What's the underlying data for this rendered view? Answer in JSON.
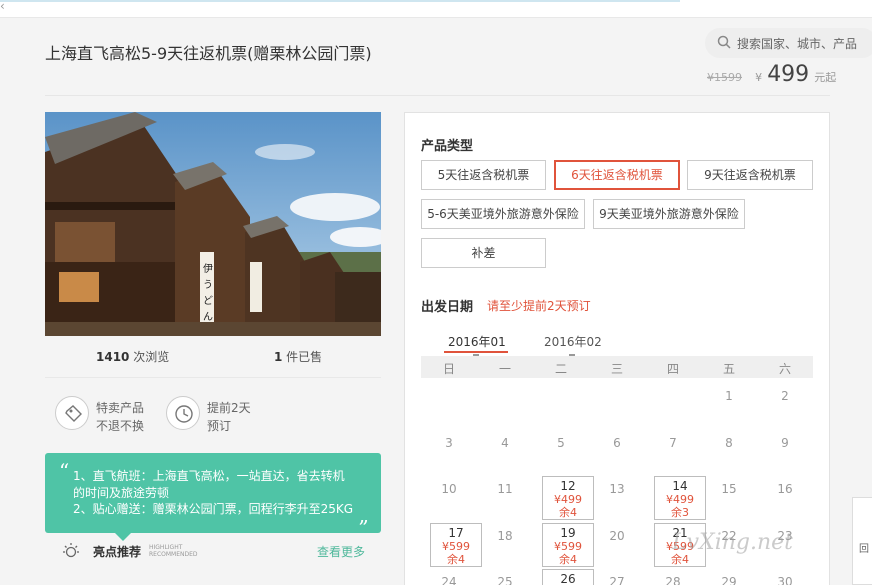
{
  "topbar": {
    "chevron": "‹"
  },
  "product": {
    "title": "上海直飞高松5-9天往返机票(赠栗林公园门票)",
    "old_price": "¥1599",
    "currency": "¥",
    "price": "499",
    "price_unit": "元起"
  },
  "search": {
    "placeholder": "搜索国家、城市、产品",
    "icon": "search-icon"
  },
  "stats": {
    "views_count": "1410",
    "views_label": " 次浏览",
    "sold_count": "1",
    "sold_label": " 件已售"
  },
  "features": [
    {
      "icon": "tag-icon",
      "line1": "特卖产品",
      "line2": "不退不换"
    },
    {
      "icon": "clock-icon",
      "line1": "提前2天",
      "line2": "预订"
    }
  ],
  "highlight": {
    "open_quote": "“",
    "close_quote": "„",
    "line1": "1、直飞航班：上海直飞高松，一站直达，省去转机",
    "line2": "的时间及旅途劳顿",
    "line3": "2、贴心赠送：赠栗林公园门票，回程行李升至25KG",
    "label": "亮点推荐",
    "label_en1": "HIGHLIGHT",
    "label_en2": "RECOMMENDED",
    "more": "查看更多",
    "icon": "sun-icon"
  },
  "product_type": {
    "title": "产品类型",
    "options": [
      "5天往返含税机票",
      "6天往返含税机票",
      "9天往返含税机票",
      "5-6天美亚境外旅游意外保险",
      "9天美亚境外旅游意外保险",
      "补差"
    ],
    "selected_index": 1
  },
  "departure": {
    "title": "出发日期",
    "note": "请至少提前2天预订",
    "months": [
      "2016年01",
      "2016年02"
    ],
    "active_month": 0,
    "weekdays": [
      "日",
      "一",
      "二",
      "三",
      "四",
      "五",
      "六"
    ],
    "plain_days": [
      "1",
      "2",
      "3",
      "4",
      "5",
      "6",
      "7",
      "8",
      "9",
      "10",
      "11",
      "13",
      "15",
      "16",
      "18",
      "20",
      "22",
      "23",
      "24",
      "25",
      "27",
      "28",
      "29",
      "30"
    ],
    "bookable": [
      {
        "day": "12",
        "price": "¥499",
        "stock": "余4"
      },
      {
        "day": "14",
        "price": "¥499",
        "stock": "余3"
      },
      {
        "day": "17",
        "price": "¥599",
        "stock": "余4"
      },
      {
        "day": "19",
        "price": "¥599",
        "stock": "余4"
      },
      {
        "day": "21",
        "price": "¥599",
        "stock": "余4"
      },
      {
        "day": "26",
        "price": "",
        "stock": ""
      }
    ]
  },
  "side_button": {
    "label": "回"
  },
  "watermark": "LvXing.net"
}
